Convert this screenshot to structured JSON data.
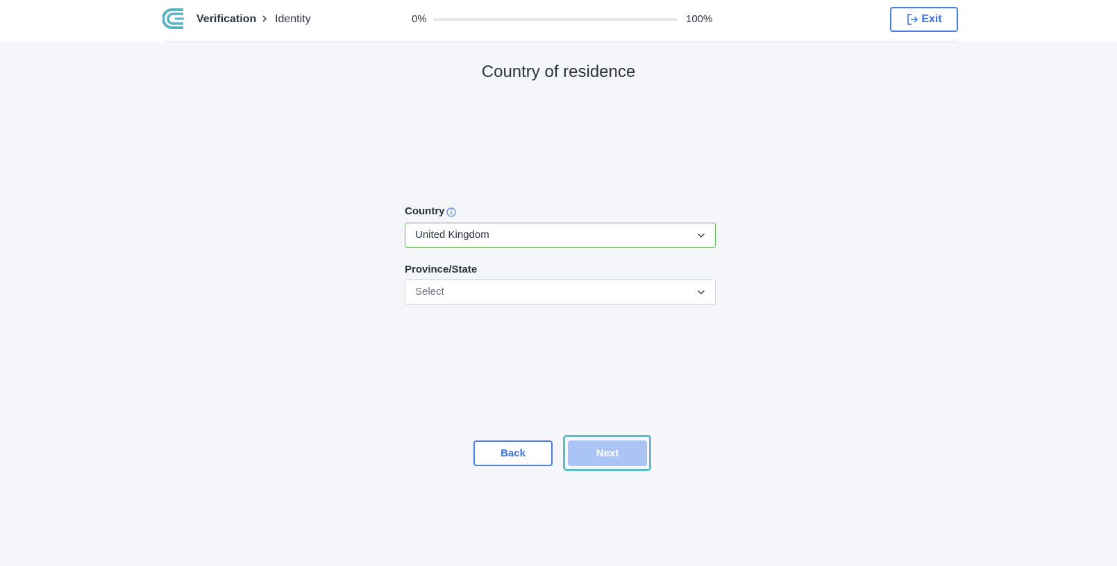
{
  "header": {
    "breadcrumb": [
      "Verification",
      "Identity"
    ],
    "progress": {
      "start_label": "0%",
      "end_label": "100%",
      "value": 0
    },
    "exit_label": "Exit"
  },
  "main": {
    "title": "Country of residence",
    "country": {
      "label": "Country",
      "value": "United Kingdom"
    },
    "province": {
      "label": "Province/State",
      "placeholder": "Select"
    }
  },
  "footer": {
    "back_label": "Back",
    "next_label": "Next"
  },
  "colors": {
    "accent": "#4a7de2",
    "success_border": "#5fb35a",
    "disabled_button": "#a9c4f5",
    "focus_ring": "#5cbcc9",
    "logo": "#5ab3c4"
  }
}
